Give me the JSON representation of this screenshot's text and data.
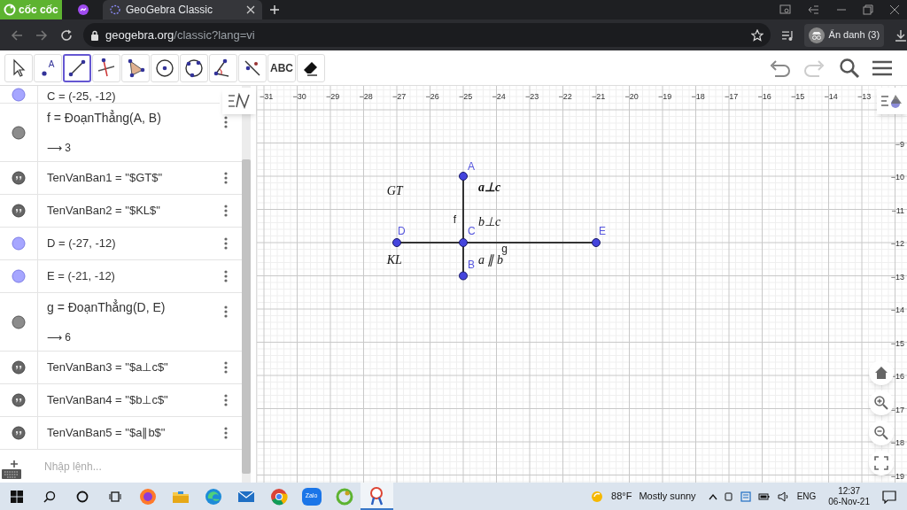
{
  "browser": {
    "logo_text": "cốc cốc",
    "tabs": [
      {
        "kind": "messenger",
        "selected": false
      },
      {
        "kind": "geogebra",
        "title": "GeoGebra Classic",
        "selected": true
      }
    ],
    "address": {
      "host": "geogebra.org",
      "path": "/classic?lang=vi"
    },
    "profile": "Ẩn danh (3)"
  },
  "toolbar": {
    "tools": [
      {
        "kind": "move",
        "selected": false
      },
      {
        "kind": "point",
        "label": "A",
        "selected": false
      },
      {
        "kind": "segment",
        "selected": true
      },
      {
        "kind": "perpendicular",
        "selected": false
      },
      {
        "kind": "polygon",
        "selected": false
      },
      {
        "kind": "circle",
        "selected": false
      },
      {
        "kind": "conic",
        "selected": false
      },
      {
        "kind": "angle",
        "selected": false
      },
      {
        "kind": "reflect",
        "selected": false
      },
      {
        "kind": "text",
        "label": "ABC",
        "selected": false
      },
      {
        "kind": "eraser",
        "selected": false
      }
    ]
  },
  "algebra": {
    "rows": [
      {
        "kind": "point",
        "text": "C = (-25, -12)",
        "menu": false
      },
      {
        "kind": "segment",
        "text": "f = ĐoạnThẳng(A, B)",
        "value": "⟶ 3",
        "menu": true
      },
      {
        "kind": "text",
        "text": "TenVanBan1 = \"$GT$\"",
        "menu": true
      },
      {
        "kind": "text",
        "text": "TenVanBan2 = \"$KL$\"",
        "menu": true
      },
      {
        "kind": "point",
        "text": "D = (-27, -12)",
        "menu": true
      },
      {
        "kind": "point",
        "text": "E = (-21, -12)",
        "menu": true
      },
      {
        "kind": "segment",
        "text": "g = ĐoạnThẳng(D, E)",
        "value": "⟶ 6",
        "menu": true
      },
      {
        "kind": "text",
        "text": "TenVanBan3 = \"$a⊥c$\"",
        "menu": true
      },
      {
        "kind": "text",
        "text": "TenVanBan4 = \"$b⊥c$\"",
        "menu": true
      },
      {
        "kind": "text",
        "text": "TenVanBan5 = \"$a∥b$\"",
        "menu": true
      }
    ],
    "input_placeholder": "Nhập lệnh..."
  },
  "graph": {
    "x_ticks": [
      "−31",
      "−30",
      "−29",
      "−28",
      "−27",
      "−26",
      "−25",
      "−24",
      "−23",
      "−22",
      "−21",
      "−20",
      "−19",
      "−18",
      "−17",
      "−16",
      "−15",
      "−14",
      "−13"
    ],
    "y_ticks": [
      "−9",
      "−10",
      "−11",
      "−12",
      "−13",
      "−14",
      "−15",
      "−16",
      "−17",
      "−18",
      "−19"
    ],
    "points": [
      {
        "label": "A"
      },
      {
        "label": "D"
      },
      {
        "label": "C"
      },
      {
        "label": "E"
      },
      {
        "label": "B"
      }
    ],
    "segments": [
      {
        "label": "f"
      },
      {
        "label": "g"
      }
    ],
    "texts": [
      {
        "text": "GT",
        "bold": false
      },
      {
        "text": "a⊥c",
        "bold": true
      },
      {
        "text": "b⊥c",
        "bold": false
      },
      {
        "text": "KL",
        "bold": false
      },
      {
        "text": "a ∥ b",
        "bold": false
      }
    ]
  },
  "taskbar": {
    "apps": [
      {
        "kind": "firefox",
        "selected": false
      },
      {
        "kind": "explorer",
        "selected": false
      },
      {
        "kind": "edge",
        "selected": false
      },
      {
        "kind": "mail",
        "selected": false
      },
      {
        "kind": "chrome",
        "selected": false
      },
      {
        "kind": "zalo",
        "label": "Zalo",
        "selected": false
      },
      {
        "kind": "coccoc",
        "selected": false
      },
      {
        "kind": "paint",
        "selected": true
      }
    ],
    "weather_temp": "88°F",
    "weather_text": "Mostly sunny",
    "language": "ENG",
    "time": "12:37",
    "date": "06-Nov-21"
  }
}
